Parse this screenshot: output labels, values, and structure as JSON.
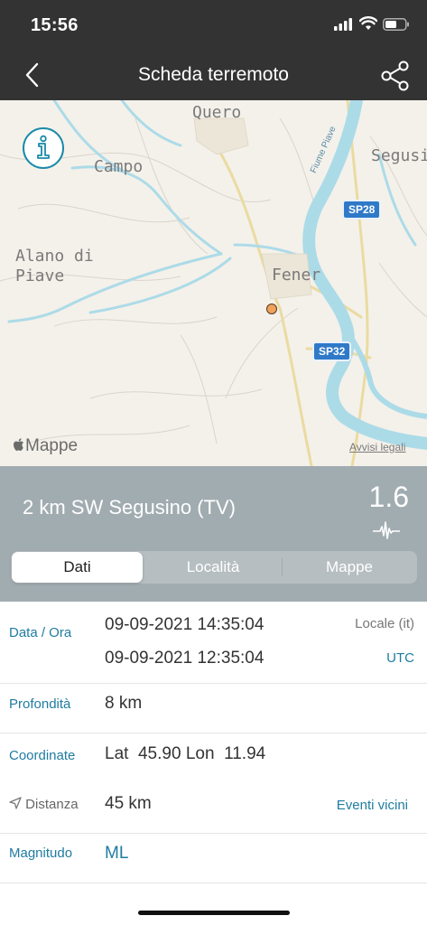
{
  "status_bar": {
    "time": "15:56"
  },
  "header": {
    "title": "Scheda terremoto"
  },
  "map": {
    "places": [
      "Quero",
      "Campo",
      "Segusi",
      "Alano di Piave",
      "Fener"
    ],
    "roads": [
      "SP28",
      "SP32"
    ],
    "river": "Fiume Piave",
    "brand": "Mappe",
    "legal": "Avvisi legali"
  },
  "summary": {
    "location": "2 km SW Segusino (TV)",
    "magnitude": "1.6"
  },
  "tabs": [
    "Dati",
    "Località",
    "Mappe"
  ],
  "details": {
    "datetime_label": "Data / Ora",
    "local_time": "09-09-2021 14:35:04",
    "local_tag": "Locale (it)",
    "utc_time": "09-09-2021 12:35:04",
    "utc_tag": "UTC",
    "depth_label": "Profondità",
    "depth": "8 km",
    "coords_label": "Coordinate",
    "lat_label": "Lat",
    "lat": "45.90",
    "lon_label": "Lon",
    "lon": "11.94",
    "distance_label": "Distanza",
    "distance": "45 km",
    "nearby_link": "Eventi vicini",
    "magnitude_label": "Magnitudo",
    "magnitude_type": "ML"
  },
  "colors": {
    "accent": "#1f7ca1",
    "bar": "#333333",
    "summary_bg": "#a1acb1"
  }
}
